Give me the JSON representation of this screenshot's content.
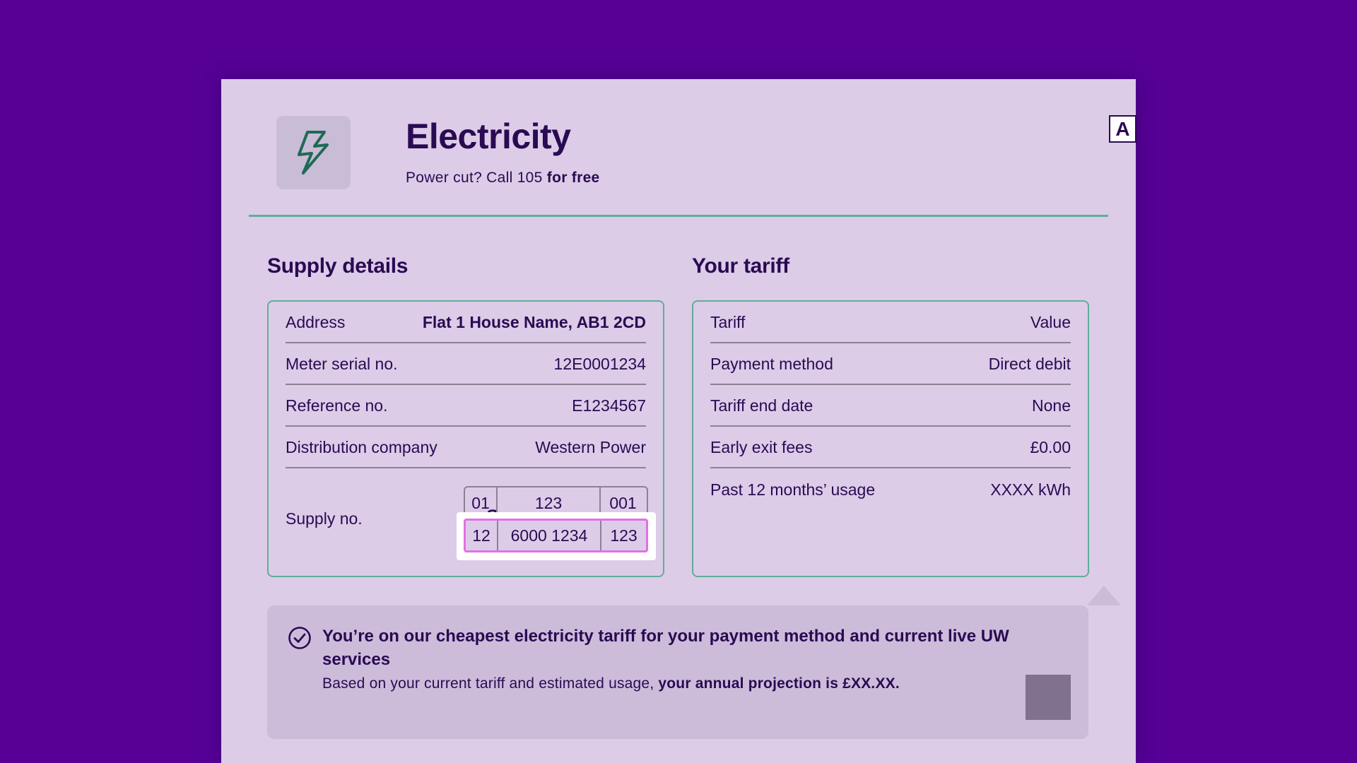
{
  "header": {
    "title": "Electricity",
    "subtitle_prefix": "Power cut? Call 105 ",
    "subtitle_bold": "for free",
    "badge": "A",
    "icon": "lightning-bolt-icon"
  },
  "supply": {
    "heading": "Supply details",
    "rows": [
      {
        "label": "Address",
        "value": "Flat 1 House Name, AB1 2CD"
      },
      {
        "label": "Meter serial no.",
        "value": "12E0001234"
      },
      {
        "label": "Reference no.",
        "value": "E1234567"
      },
      {
        "label": "Distribution company",
        "value": "Western Power"
      }
    ],
    "supply_no_label": "Supply no.",
    "supply_prefix": "S",
    "top_row": [
      "01",
      "123",
      "001"
    ],
    "bottom_row": [
      "12",
      "6000 1234",
      "123"
    ]
  },
  "tariff": {
    "heading": "Your tariff",
    "rows": [
      {
        "label": "Tariff",
        "value": "Value"
      },
      {
        "label": "Payment method",
        "value": "Direct debit"
      },
      {
        "label": "Tariff end date",
        "value": "None"
      },
      {
        "label": "Early exit fees",
        "value": "£0.00"
      },
      {
        "label": "Past 12 months’ usage",
        "value": "XXXX kWh"
      }
    ]
  },
  "notice": {
    "icon": "check-circle-icon",
    "title": "You’re on our cheapest electricity tariff for your payment method and current live UW services",
    "text_prefix": "Based on your current tariff and estimated usage, ",
    "text_bold": "your annual projection is £XX.XX."
  },
  "colors": {
    "background": "#560096",
    "card": "#dccce8",
    "accent_green": "#5fae98",
    "highlight_pink": "#e36fe6",
    "text": "#2a0a52"
  }
}
